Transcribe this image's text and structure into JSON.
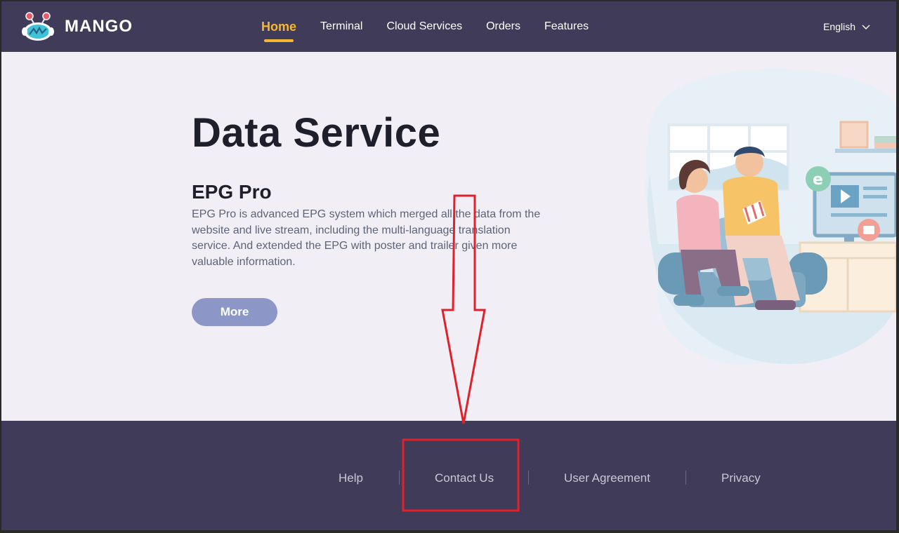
{
  "header": {
    "brand": "MANGO",
    "nav": [
      {
        "label": "Home",
        "active": true
      },
      {
        "label": "Terminal",
        "active": false
      },
      {
        "label": "Cloud Services",
        "active": false
      },
      {
        "label": "Orders",
        "active": false
      },
      {
        "label": "Features",
        "active": false
      }
    ],
    "language": "English"
  },
  "hero": {
    "title": "Data Service",
    "subtitle": "EPG Pro",
    "description": "EPG Pro is advanced EPG system which merged all the data from the website and live stream, including the multi-language translation service. And extended the EPG with poster and trailer given more valuable information.",
    "button": "More"
  },
  "footer": {
    "links": [
      "Help",
      "Contact Us",
      "User Agreement",
      "Privacy"
    ]
  },
  "colors": {
    "header_bg": "#413b5a",
    "accent": "#f5b82e",
    "button": "#8c97c8",
    "annotation": "#e0202a"
  },
  "icons": [
    "mango-logo-icon",
    "chevron-down-icon"
  ]
}
